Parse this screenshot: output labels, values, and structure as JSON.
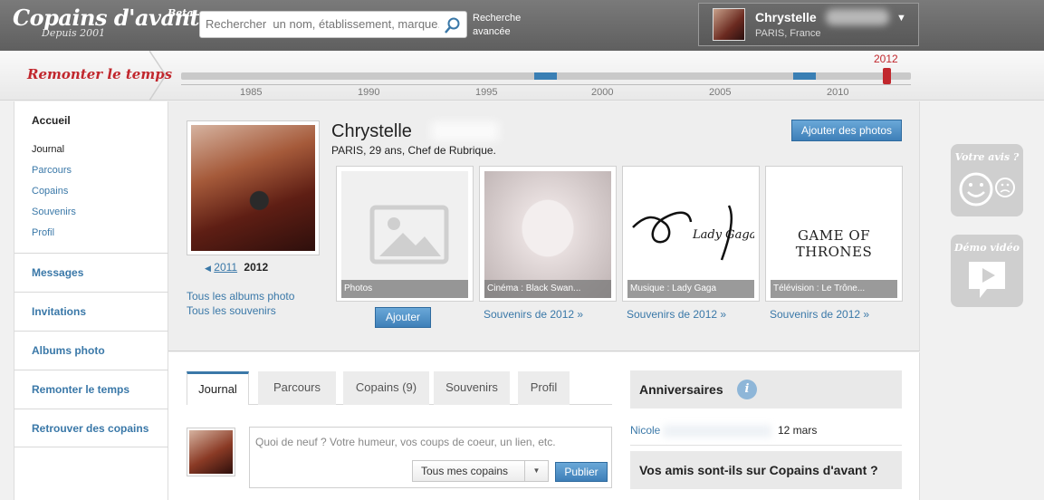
{
  "header": {
    "logo": "Copains d'avant",
    "logo_badge": "Beta",
    "logo_sub": "Depuis 2001",
    "search_placeholder": "Rechercher  un nom, établissement, marque...",
    "advanced_search": "Recherche avancée",
    "user": {
      "name": "Chrystelle",
      "location": "PARIS, France"
    }
  },
  "timeline": {
    "label": "Remonter le temps",
    "current_year": "2012",
    "years": [
      "1985",
      "1990",
      "1995",
      "2000",
      "2005",
      "2010"
    ]
  },
  "sidebar": {
    "main": "Accueil",
    "sub_items": [
      "Journal",
      "Parcours",
      "Copains",
      "Souvenirs",
      "Profil"
    ],
    "sections": [
      "Messages",
      "Invitations",
      "Albums photo",
      "Remonter le temps",
      "Retrouver des copains"
    ]
  },
  "profile": {
    "name": "Chrystelle",
    "info": "PARIS, 29 ans, Chef de Rubrique.",
    "add_photos_label": "Ajouter des photos",
    "year_prev": "2011",
    "year_current": "2012",
    "all_albums": "Tous les albums photo",
    "all_souvenirs": "Tous les souvenirs",
    "add_label": "Ajouter",
    "cards": [
      {
        "caption": "Photos",
        "link": ""
      },
      {
        "caption": "Cinéma : Black Swan...",
        "link": "Souvenirs de 2012 »"
      },
      {
        "caption": "Musique : Lady Gaga",
        "link": "Souvenirs de 2012 »"
      },
      {
        "caption": "Télévision : Le Trône...",
        "link": "Souvenirs de 2012 »"
      }
    ],
    "card3_art": "Lady Gaga",
    "card4_art": "GAME OF THRONES"
  },
  "tabs": [
    {
      "label": "Journal",
      "active": true
    },
    {
      "label": "Parcours",
      "active": false
    },
    {
      "label": "Copains (9)",
      "active": false
    },
    {
      "label": "Souvenirs",
      "active": false
    },
    {
      "label": "Profil",
      "active": false
    }
  ],
  "post": {
    "placeholder": "Quoi de neuf ? Votre humeur, vos coups de coeur, un lien, etc.",
    "audience": "Tous mes copains",
    "publish": "Publier"
  },
  "birthdays": {
    "title": "Anniversaires",
    "info_icon": "i",
    "entries": [
      {
        "name": "Nicole",
        "date": "12 mars"
      }
    ]
  },
  "friends_widget": {
    "title": "Vos amis sont-ils sur Copains d'avant ?"
  },
  "side_widgets": {
    "feedback": "Votre avis ?",
    "demo": "Démo vidéo"
  },
  "colors": {
    "accent": "#3a78a8",
    "brand_red": "#c1272d",
    "header_bg": "#6b6b6b"
  }
}
